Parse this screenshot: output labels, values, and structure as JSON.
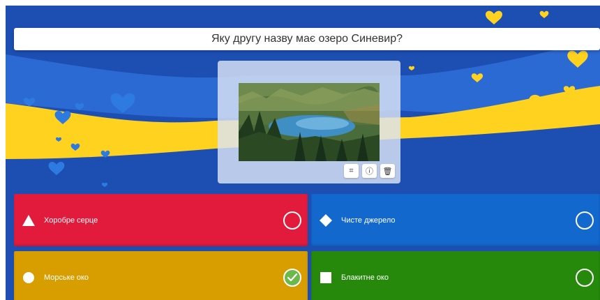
{
  "question": {
    "text": "Яку другу назву має озеро Синевир?"
  },
  "media": {
    "tools": [
      {
        "name": "crop-icon",
        "glyph": "⌗"
      },
      {
        "name": "info-icon",
        "glyph": "ⓘ"
      },
      {
        "name": "trash-icon",
        "glyph": "🗑"
      }
    ]
  },
  "answers": [
    {
      "label": "Хоробре серце",
      "shape": "triangle",
      "color": "#e21b3c",
      "correct": false
    },
    {
      "label": "Чисте джерело",
      "shape": "diamond",
      "color": "#1368ce",
      "correct": false
    },
    {
      "label": "Морське око",
      "shape": "circle",
      "color": "#d89e00",
      "correct": true
    },
    {
      "label": "Блакитне око",
      "shape": "square",
      "color": "#26890c",
      "correct": false
    }
  ],
  "theme": {
    "blue": "#1d4fb3",
    "yellow": "#ffd21f"
  }
}
